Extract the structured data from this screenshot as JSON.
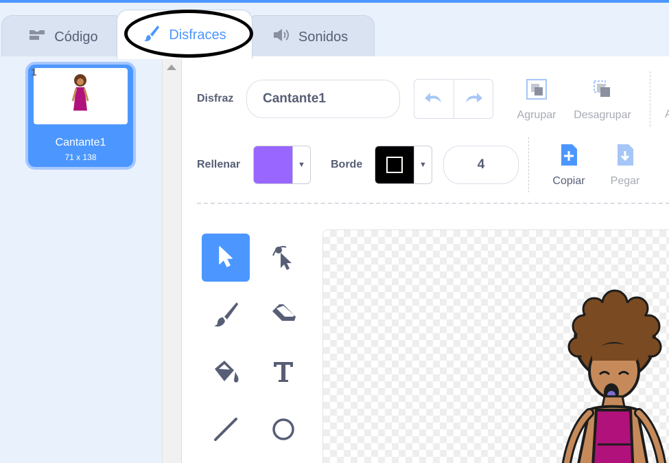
{
  "tabs": {
    "code": {
      "label": "Código",
      "icon": "code-blocks-icon"
    },
    "costumes": {
      "label": "Disfraces",
      "icon": "paintbrush-icon"
    },
    "sounds": {
      "label": "Sonidos",
      "icon": "speaker-icon"
    }
  },
  "costume_list": [
    {
      "number": "1",
      "name": "Cantante1",
      "size": "71 x 138"
    }
  ],
  "toolbar": {
    "costume_label": "Disfraz",
    "costume_name": "Cantante1",
    "group_label": "Agrupar",
    "ungroup_label": "Desagrupar",
    "fill_label": "Rellenar",
    "outline_label": "Borde",
    "outline_width": "4",
    "copy_label": "Copiar",
    "paste_label": "Pegar",
    "truncated_label": "A"
  },
  "colors": {
    "accent": "#4c97ff",
    "fill_color": "#9966ff",
    "outline_color": "#000000"
  },
  "tools": [
    "select-tool",
    "reshape-tool",
    "brush-tool",
    "eraser-tool",
    "fill-tool",
    "text-tool",
    "line-tool",
    "circle-tool"
  ]
}
